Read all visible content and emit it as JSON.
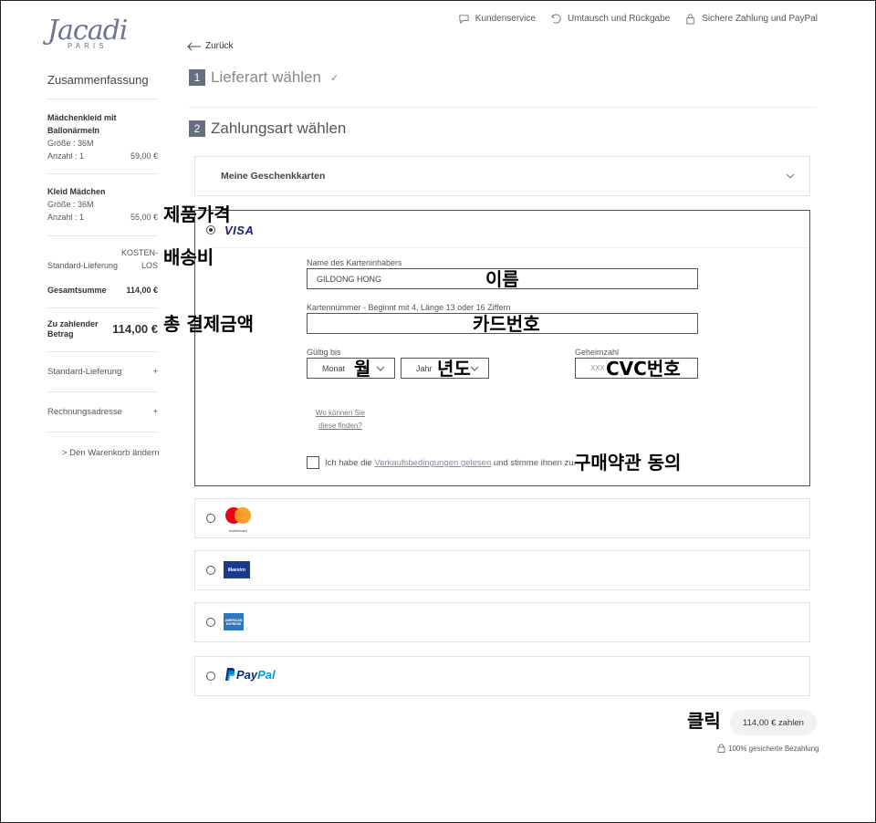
{
  "brand": {
    "name": "Jacadi",
    "sub": "PARIS"
  },
  "topnav": [
    {
      "label": "Kundenservice",
      "icon": "chat-icon"
    },
    {
      "label": "Umtausch und Rückgabe",
      "icon": "return-icon"
    },
    {
      "label": "Sichere Zahlung und PayPal",
      "icon": "lock-icon"
    }
  ],
  "back_label": "Zurück",
  "sidebar": {
    "title": "Zusammenfassung",
    "items": [
      {
        "name_line1": "Mädchenkleid mit",
        "name_line2": "Ballonärmeln",
        "size": "Größe : 36M",
        "qty": "Anzahl : 1",
        "price": "59,00 €"
      },
      {
        "name": "Kleid Mädchen",
        "size": "Größe : 36M",
        "qty": "Anzahl : 1",
        "price": "55,00 €"
      }
    ],
    "shipping_label": "Standard-Lieferung",
    "shipping_value_line1": "KOSTEN-",
    "shipping_value_line2": "LOS",
    "total_label": "Gesamtsumme",
    "total_value": "114,00 €",
    "pay_label_line1": "Zu zahlender",
    "pay_label_line2": "Betrag",
    "pay_value": "114,00 €",
    "accordions": [
      "Standard-Lieferung",
      "Rechnungsadresse"
    ],
    "cart_link": "> Den Warenkorb ändern"
  },
  "steps": [
    {
      "num": "1",
      "title": "Lieferart wählen",
      "check": "✓"
    },
    {
      "num": "2",
      "title": "Zahlungsart wählen"
    }
  ],
  "giftcards": "Meine Geschenkkarten",
  "card_form": {
    "brand": "VISA",
    "holder_label": "Name des Karteninhabers",
    "holder_value": "GILDONG HONG",
    "number_label": "Kartennummer - Beginnt mit 4, Länge 13 oder 16 Ziffern",
    "valid_label": "Gültig bis",
    "month_value": "Monat",
    "year_value": "Jahr",
    "cvc_label": "Geheimzahl",
    "cvc_placeholder": "XXX",
    "help_line1": "Wo können Sie",
    "help_line2": "diese finden?",
    "terms_pre": "Ich habe die ",
    "terms_link": "Verkaufsbedingungen gelesen",
    "terms_post": " und stimme ihnen zu."
  },
  "methods": {
    "mastercard": "mastercard",
    "maestro": "Maestro",
    "amex": "AMERICAN EXPRESS",
    "paypal_pay": "Pay",
    "paypal_pal": "Pal"
  },
  "pay_button": "114,00 € zahlen",
  "secure_text": "100% gesicherte Bezahlung",
  "annotations": {
    "product_price": "제품가격",
    "shipping": "배송비",
    "total": "총 결제금액",
    "name": "이름",
    "card_number": "카드번호",
    "month": "월",
    "year": "년도",
    "cvc": "CVC번호",
    "terms": "구매약관 동의",
    "click": "클릭"
  },
  "colors": {
    "accent": "#666e80",
    "visa": "#1a1f71",
    "paypal_dark": "#003087",
    "paypal_light": "#009cde",
    "link": "#7b8bb1"
  }
}
